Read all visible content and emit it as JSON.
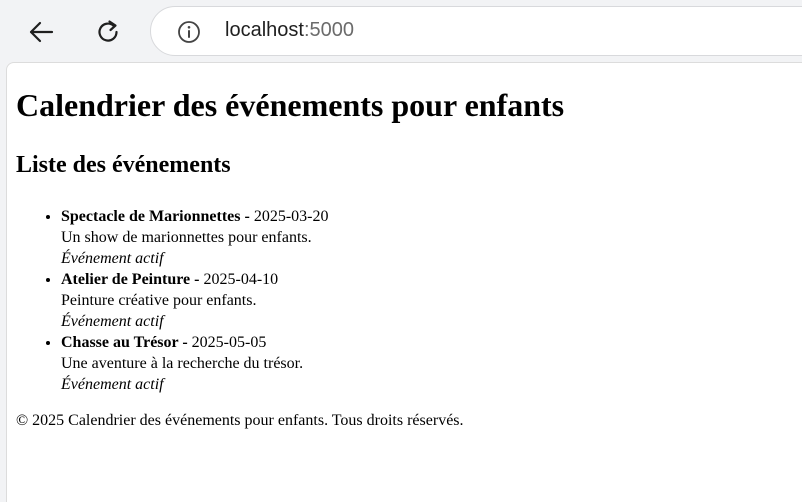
{
  "browser": {
    "url_host": "localhost",
    "url_port": ":5000"
  },
  "page": {
    "title": "Calendrier des événements pour enfants",
    "subtitle": "Liste des événements",
    "events": [
      {
        "name": "Spectacle de Marionnettes -",
        "date": " 2025-03-20",
        "description": "Un show de marionnettes pour enfants.",
        "status": "Événement actif"
      },
      {
        "name": "Atelier de Peinture -",
        "date": " 2025-04-10",
        "description": "Peinture créative pour enfants.",
        "status": "Événement actif"
      },
      {
        "name": "Chasse au Trésor -",
        "date": " 2025-05-05",
        "description": "Une aventure à la recherche du trésor.",
        "status": "Événement actif"
      }
    ],
    "footer": "© 2025 Calendrier des événements pour enfants. Tous droits réservés."
  },
  "icons": [
    "back-arrow-icon",
    "reload-icon",
    "info-icon"
  ]
}
